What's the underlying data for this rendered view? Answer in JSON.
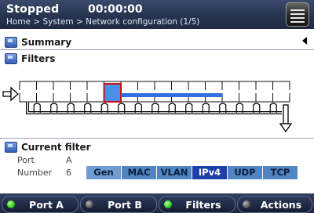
{
  "header": {
    "status": "Stopped",
    "timer": "00:00:00",
    "breadcrumb": "Home > System > Network configuration (1/5)"
  },
  "sections": {
    "summary": "Summary",
    "filters": "Filters",
    "current_filter": "Current filter"
  },
  "current_filter": {
    "port_label": "Port",
    "port_value": "A",
    "number_label": "Number",
    "number_value": "6"
  },
  "tabs": [
    {
      "label": "Gen"
    },
    {
      "label": "MAC"
    },
    {
      "label": "VLAN"
    },
    {
      "label": "IPv4"
    },
    {
      "label": "UDP"
    },
    {
      "label": "TCP"
    }
  ],
  "bottom_buttons": [
    {
      "label": "Port A",
      "led": "on"
    },
    {
      "label": "Port B",
      "led": "off"
    },
    {
      "label": "Filters",
      "led": "on"
    },
    {
      "label": "Actions",
      "led": "off"
    }
  ],
  "diagram": {
    "filter_count": 16,
    "selected_filter": 6,
    "colors": {
      "accent": "#2f6fe0",
      "selected_border": "#cc1111"
    }
  }
}
